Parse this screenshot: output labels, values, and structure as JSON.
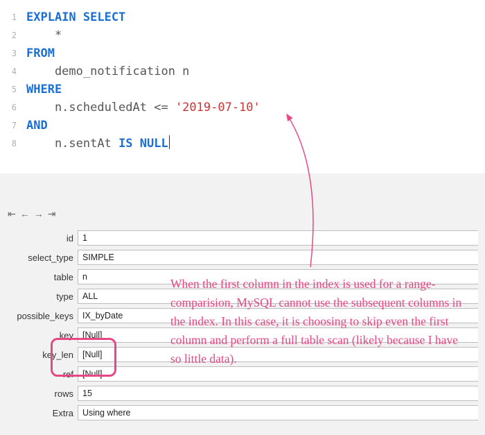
{
  "editor": {
    "lines": [
      {
        "n": "1",
        "tokens": [
          {
            "cls": "kw",
            "t": "EXPLAIN SELECT"
          }
        ]
      },
      {
        "n": "2",
        "tokens": [
          {
            "cls": "plain",
            "t": "    *"
          }
        ]
      },
      {
        "n": "3",
        "tokens": [
          {
            "cls": "kw",
            "t": "FROM"
          }
        ]
      },
      {
        "n": "4",
        "tokens": [
          {
            "cls": "plain",
            "t": "    demo_notification n"
          }
        ]
      },
      {
        "n": "5",
        "tokens": [
          {
            "cls": "kw",
            "t": "WHERE"
          }
        ]
      },
      {
        "n": "6",
        "tokens": [
          {
            "cls": "plain",
            "t": "    n.scheduledAt <= "
          },
          {
            "cls": "str",
            "t": "'2019-07-10'"
          }
        ]
      },
      {
        "n": "7",
        "tokens": [
          {
            "cls": "kw",
            "t": "AND"
          }
        ]
      },
      {
        "n": "8",
        "tokens": [
          {
            "cls": "plain",
            "t": "    n.sentAt "
          },
          {
            "cls": "kw",
            "t": "IS NULL"
          }
        ],
        "cursor": true
      }
    ]
  },
  "nav": {
    "first": "⇤",
    "prev": "←",
    "next": "→",
    "last": "⇥"
  },
  "rows": [
    {
      "label": "id",
      "value": "1"
    },
    {
      "label": "select_type",
      "value": "SIMPLE"
    },
    {
      "label": "table",
      "value": "n"
    },
    {
      "label": "type",
      "value": "ALL"
    },
    {
      "label": "possible_keys",
      "value": "IX_byDate"
    },
    {
      "label": "key",
      "value": "[Null]"
    },
    {
      "label": "key_len",
      "value": "[Null]"
    },
    {
      "label": "ref",
      "value": "[Null]"
    },
    {
      "label": "rows",
      "value": "15"
    },
    {
      "label": "Extra",
      "value": "Using where"
    }
  ],
  "annotation": "When the first column in the index is used for a range-comparision, MySQL cannot use the subsequent columns in the index. In this case, it is choosing to skip even the first column and perform a full table scan (likely because I have so little data).",
  "colors": {
    "accent": "#e84785"
  }
}
